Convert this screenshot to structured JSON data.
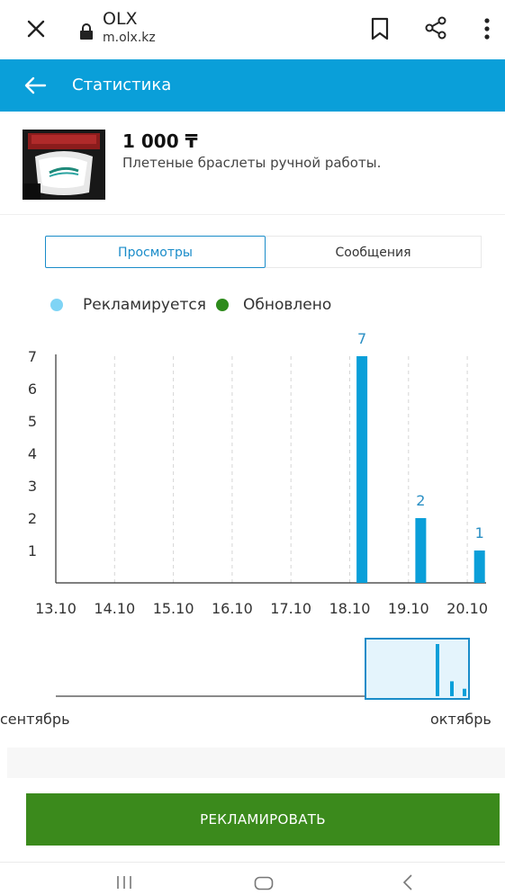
{
  "browser": {
    "site_title": "OLX",
    "url": "m.olx.kz"
  },
  "appbar": {
    "title": "Статистика"
  },
  "product": {
    "price": "1 000 ₸",
    "name": "Плетеные браслеты ручной работы."
  },
  "tabs": [
    {
      "label": "Просмотры",
      "active": true
    },
    {
      "label": "Сообщения",
      "active": false
    }
  ],
  "legend": [
    {
      "label": "Рекламируется",
      "color": "#7fd4f5"
    },
    {
      "label": "Обновлено",
      "color": "#2e8b1c"
    }
  ],
  "chart_data": {
    "type": "bar",
    "categories": [
      "13.10",
      "14.10",
      "15.10",
      "16.10",
      "17.10",
      "18.10",
      "19.10",
      "20.10"
    ],
    "values": [
      0,
      0,
      0,
      0,
      0,
      7,
      2,
      1
    ],
    "yticks": [
      1,
      2,
      3,
      4,
      5,
      6,
      7
    ],
    "ylim": [
      0,
      7
    ],
    "bar_color": "#0a9fd9",
    "label_color": "#2a8fc4",
    "grid": "vertical dashed"
  },
  "navigator": {
    "start_label": "сентябрь",
    "end_label": "октябрь"
  },
  "promote_button": {
    "label": "РЕКЛАМИРОВАТЬ"
  },
  "colors": {
    "appbar": "#0a9fd9",
    "button": "#3b8a1c",
    "active_tab": "#1a8cc9"
  }
}
